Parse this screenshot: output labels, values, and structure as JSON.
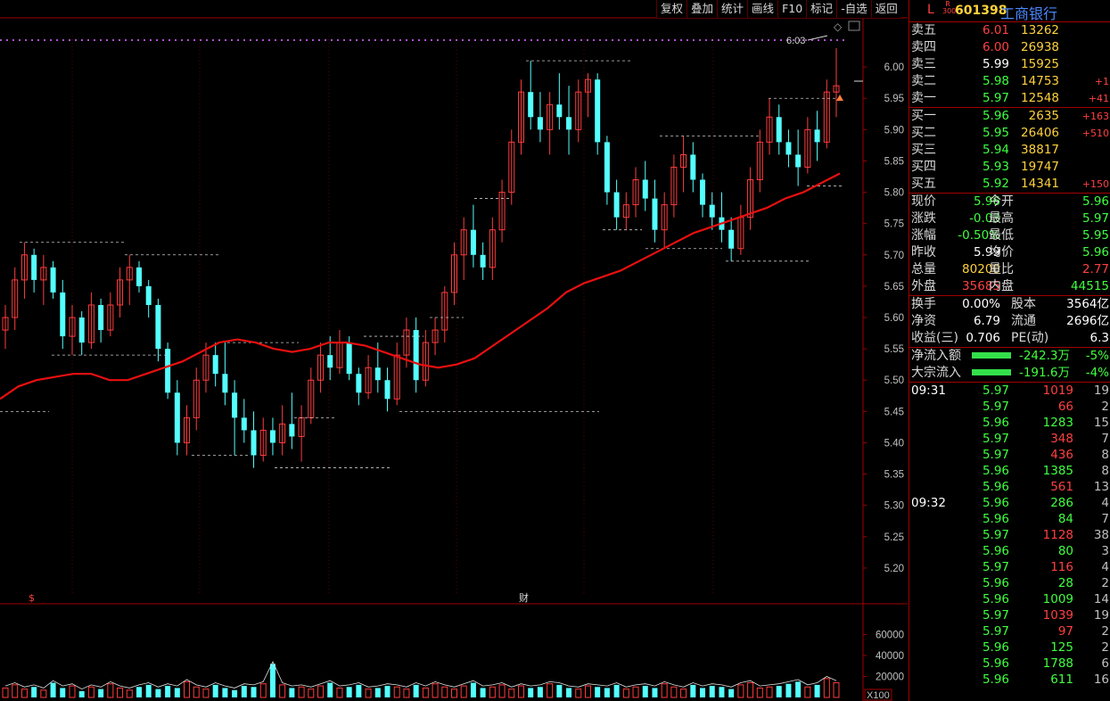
{
  "toolbar": {
    "buttons": [
      "复权",
      "叠加",
      "统计",
      "画线",
      "F10",
      "标记",
      "-自选",
      "返回"
    ]
  },
  "stock": {
    "flag": "L",
    "index_tag": "R 300",
    "code": "601398",
    "name": "工商银行"
  },
  "order_book": {
    "asks": [
      {
        "label": "卖五",
        "price": "6.01",
        "vol": "13262",
        "chg": ""
      },
      {
        "label": "卖四",
        "price": "6.00",
        "vol": "26938",
        "chg": ""
      },
      {
        "label": "卖三",
        "price": "5.99",
        "vol": "15925",
        "chg": ""
      },
      {
        "label": "卖二",
        "price": "5.98",
        "vol": "14753",
        "chg": "+1"
      },
      {
        "label": "卖一",
        "price": "5.97",
        "vol": "12548",
        "chg": "+41"
      }
    ],
    "bids": [
      {
        "label": "买一",
        "price": "5.96",
        "vol": "2635",
        "chg": "+163"
      },
      {
        "label": "买二",
        "price": "5.95",
        "vol": "26406",
        "chg": "+510"
      },
      {
        "label": "买三",
        "price": "5.94",
        "vol": "38817",
        "chg": ""
      },
      {
        "label": "买四",
        "price": "5.93",
        "vol": "19747",
        "chg": ""
      },
      {
        "label": "买五",
        "price": "5.92",
        "vol": "14341",
        "chg": "+150"
      }
    ]
  },
  "quote": {
    "xianjia_l": "现价",
    "xianjia": "5.96",
    "jinkai_l": "今开",
    "jinkai": "5.96",
    "zhangdie_l": "涨跌",
    "zhangdie": "-0.03",
    "zuigao_l": "最高",
    "zuigao": "5.97",
    "zhangfu_l": "涨幅",
    "zhangfu": "-0.50%",
    "zuidi_l": "最低",
    "zuidi": "5.95",
    "zuoshou_l": "昨收",
    "zuoshou": "5.99",
    "junjia_l": "均价",
    "junjia": "5.96",
    "zongliang_l": "总量",
    "zongliang": "80200",
    "liangbi_l": "量比",
    "liangbi": "2.77",
    "waipan_l": "外盘",
    "waipan": "35685",
    "neipan_l": "内盘",
    "neipan": "44515"
  },
  "fundamentals": {
    "huanshou_l": "换手",
    "huanshou": "0.00%",
    "guben_l": "股本",
    "guben": "3564亿",
    "jingzi_l": "净资",
    "jingzi": "6.79",
    "liutong_l": "流通",
    "liutong": "2696亿",
    "shouyi_l": "收益(三)",
    "shouyi": "0.706",
    "pe_l": "PE(动)",
    "pe": "6.3"
  },
  "flows": [
    {
      "label": "净流入额",
      "value": "-242.3万",
      "pct": "-5%"
    },
    {
      "label": "大宗流入",
      "value": "-191.6万",
      "pct": "-4%"
    }
  ],
  "ticks": [
    {
      "time": "09:31",
      "price": "5.97",
      "vol": "1019",
      "n": "19",
      "dir": "up",
      "pdir": "dn"
    },
    {
      "time": "",
      "price": "5.97",
      "vol": "66",
      "n": "2",
      "dir": "up",
      "pdir": "dn"
    },
    {
      "time": "",
      "price": "5.96",
      "vol": "1283",
      "n": "15",
      "dir": "dn",
      "pdir": "dn"
    },
    {
      "time": "",
      "price": "5.97",
      "vol": "348",
      "n": "7",
      "dir": "up",
      "pdir": "dn"
    },
    {
      "time": "",
      "price": "5.97",
      "vol": "436",
      "n": "8",
      "dir": "up",
      "pdir": "dn"
    },
    {
      "time": "",
      "price": "5.96",
      "vol": "1385",
      "n": "8",
      "dir": "dn",
      "pdir": "dn"
    },
    {
      "time": "",
      "price": "5.96",
      "vol": "561",
      "n": "13",
      "dir": "up",
      "pdir": "dn"
    },
    {
      "time": "09:32",
      "price": "5.96",
      "vol": "286",
      "n": "4",
      "dir": "dn",
      "pdir": "dn"
    },
    {
      "time": "",
      "price": "5.96",
      "vol": "84",
      "n": "7",
      "dir": "dn",
      "pdir": "dn"
    },
    {
      "time": "",
      "price": "5.97",
      "vol": "1128",
      "n": "38",
      "dir": "up",
      "pdir": "dn"
    },
    {
      "time": "",
      "price": "5.96",
      "vol": "80",
      "n": "3",
      "dir": "dn",
      "pdir": "dn"
    },
    {
      "time": "",
      "price": "5.97",
      "vol": "116",
      "n": "4",
      "dir": "up",
      "pdir": "dn"
    },
    {
      "time": "",
      "price": "5.96",
      "vol": "28",
      "n": "2",
      "dir": "dn",
      "pdir": "dn"
    },
    {
      "time": "",
      "price": "5.96",
      "vol": "1009",
      "n": "14",
      "dir": "dn",
      "pdir": "dn"
    },
    {
      "time": "",
      "price": "5.97",
      "vol": "1039",
      "n": "19",
      "dir": "up",
      "pdir": "dn"
    },
    {
      "time": "",
      "price": "5.97",
      "vol": "97",
      "n": "2",
      "dir": "up",
      "pdir": "dn"
    },
    {
      "time": "",
      "price": "5.96",
      "vol": "125",
      "n": "2",
      "dir": "dn",
      "pdir": "dn"
    },
    {
      "time": "",
      "price": "5.96",
      "vol": "1788",
      "n": "6",
      "dir": "dn",
      "pdir": "dn"
    },
    {
      "time": "",
      "price": "5.96",
      "vol": "611",
      "n": "16",
      "dir": "dn",
      "pdir": "dn"
    }
  ],
  "chart_data": {
    "type": "candlestick",
    "price_axis": {
      "ticks": [
        "6.00",
        "5.95",
        "5.90",
        "5.85",
        "5.80",
        "5.75",
        "5.70",
        "5.65",
        "5.60",
        "5.55",
        "5.50",
        "5.45",
        "5.40",
        "5.35",
        "5.30",
        "5.25",
        "5.20"
      ],
      "ylim": [
        5.16,
        6.05
      ]
    },
    "volume_axis": {
      "ticks": [
        "60000",
        "40000",
        "20000"
      ],
      "unit": "X100",
      "ylim": [
        0,
        80000
      ]
    },
    "annotations": {
      "high_label": "6.03",
      "event_marker_1": "$",
      "event_marker_2": "财"
    },
    "colors": {
      "up": "#ff3c3c",
      "down": "#54ffff",
      "ma": "#e81010",
      "dash": "#c8c8c8"
    },
    "candles": [
      [
        5.58,
        5.62,
        5.55,
        5.6
      ],
      [
        5.6,
        5.68,
        5.58,
        5.66
      ],
      [
        5.66,
        5.72,
        5.63,
        5.7
      ],
      [
        5.7,
        5.71,
        5.64,
        5.66
      ],
      [
        5.66,
        5.7,
        5.62,
        5.68
      ],
      [
        5.68,
        5.69,
        5.63,
        5.64
      ],
      [
        5.64,
        5.66,
        5.55,
        5.57
      ],
      [
        5.57,
        5.62,
        5.54,
        5.6
      ],
      [
        5.6,
        5.61,
        5.54,
        5.56
      ],
      [
        5.56,
        5.64,
        5.55,
        5.62
      ],
      [
        5.62,
        5.63,
        5.56,
        5.58
      ],
      [
        5.58,
        5.64,
        5.57,
        5.62
      ],
      [
        5.62,
        5.68,
        5.6,
        5.66
      ],
      [
        5.66,
        5.7,
        5.62,
        5.68
      ],
      [
        5.68,
        5.69,
        5.64,
        5.65
      ],
      [
        5.65,
        5.66,
        5.6,
        5.62
      ],
      [
        5.62,
        5.63,
        5.53,
        5.55
      ],
      [
        5.55,
        5.56,
        5.47,
        5.48
      ],
      [
        5.48,
        5.5,
        5.38,
        5.4
      ],
      [
        5.4,
        5.46,
        5.38,
        5.44
      ],
      [
        5.44,
        5.52,
        5.42,
        5.5
      ],
      [
        5.5,
        5.56,
        5.48,
        5.54
      ],
      [
        5.54,
        5.56,
        5.49,
        5.51
      ],
      [
        5.51,
        5.56,
        5.46,
        5.48
      ],
      [
        5.48,
        5.5,
        5.38,
        5.44
      ],
      [
        5.44,
        5.47,
        5.4,
        5.42
      ],
      [
        5.42,
        5.45,
        5.36,
        5.38
      ],
      [
        5.38,
        5.44,
        5.37,
        5.42
      ],
      [
        5.42,
        5.44,
        5.38,
        5.4
      ],
      [
        5.4,
        5.46,
        5.38,
        5.43
      ],
      [
        5.43,
        5.48,
        5.39,
        5.41
      ],
      [
        5.41,
        5.46,
        5.37,
        5.44
      ],
      [
        5.44,
        5.52,
        5.43,
        5.5
      ],
      [
        5.5,
        5.56,
        5.48,
        5.54
      ],
      [
        5.54,
        5.57,
        5.5,
        5.52
      ],
      [
        5.52,
        5.58,
        5.51,
        5.56
      ],
      [
        5.56,
        5.57,
        5.5,
        5.51
      ],
      [
        5.51,
        5.52,
        5.46,
        5.48
      ],
      [
        5.48,
        5.54,
        5.47,
        5.52
      ],
      [
        5.52,
        5.56,
        5.48,
        5.5
      ],
      [
        5.5,
        5.52,
        5.45,
        5.47
      ],
      [
        5.47,
        5.56,
        5.46,
        5.54
      ],
      [
        5.54,
        5.6,
        5.52,
        5.58
      ],
      [
        5.58,
        5.6,
        5.48,
        5.5
      ],
      [
        5.5,
        5.58,
        5.49,
        5.56
      ],
      [
        5.56,
        5.6,
        5.54,
        5.58
      ],
      [
        5.58,
        5.65,
        5.56,
        5.64
      ],
      [
        5.64,
        5.72,
        5.62,
        5.7
      ],
      [
        5.7,
        5.76,
        5.66,
        5.74
      ],
      [
        5.74,
        5.78,
        5.68,
        5.7
      ],
      [
        5.7,
        5.72,
        5.66,
        5.68
      ],
      [
        5.68,
        5.76,
        5.66,
        5.74
      ],
      [
        5.74,
        5.82,
        5.72,
        5.8
      ],
      [
        5.8,
        5.9,
        5.78,
        5.88
      ],
      [
        5.88,
        5.98,
        5.86,
        5.96
      ],
      [
        5.96,
        6.01,
        5.9,
        5.92
      ],
      [
        5.92,
        5.96,
        5.88,
        5.9
      ],
      [
        5.9,
        5.96,
        5.86,
        5.94
      ],
      [
        5.94,
        5.99,
        5.9,
        5.92
      ],
      [
        5.92,
        5.97,
        5.86,
        5.9
      ],
      [
        5.9,
        5.98,
        5.88,
        5.96
      ],
      [
        5.96,
        5.99,
        5.92,
        5.98
      ],
      [
        5.98,
        5.99,
        5.86,
        5.88
      ],
      [
        5.88,
        5.89,
        5.78,
        5.8
      ],
      [
        5.8,
        5.82,
        5.74,
        5.76
      ],
      [
        5.76,
        5.8,
        5.74,
        5.78
      ],
      [
        5.78,
        5.84,
        5.76,
        5.82
      ],
      [
        5.82,
        5.85,
        5.77,
        5.79
      ],
      [
        5.79,
        5.82,
        5.72,
        5.74
      ],
      [
        5.74,
        5.8,
        5.71,
        5.78
      ],
      [
        5.78,
        5.86,
        5.76,
        5.84
      ],
      [
        5.84,
        5.89,
        5.8,
        5.86
      ],
      [
        5.86,
        5.88,
        5.8,
        5.82
      ],
      [
        5.82,
        5.83,
        5.76,
        5.78
      ],
      [
        5.78,
        5.8,
        5.74,
        5.76
      ],
      [
        5.76,
        5.8,
        5.72,
        5.74
      ],
      [
        5.74,
        5.76,
        5.69,
        5.71
      ],
      [
        5.71,
        5.78,
        5.7,
        5.76
      ],
      [
        5.76,
        5.84,
        5.74,
        5.82
      ],
      [
        5.82,
        5.9,
        5.8,
        5.88
      ],
      [
        5.88,
        5.95,
        5.86,
        5.92
      ],
      [
        5.92,
        5.94,
        5.86,
        5.88
      ],
      [
        5.88,
        5.9,
        5.84,
        5.86
      ],
      [
        5.86,
        5.9,
        5.81,
        5.84
      ],
      [
        5.84,
        5.92,
        5.83,
        5.9
      ],
      [
        5.9,
        5.93,
        5.85,
        5.88
      ],
      [
        5.88,
        5.98,
        5.87,
        5.96
      ],
      [
        5.96,
        6.03,
        5.92,
        5.97
      ]
    ],
    "ma": [
      5.47,
      5.49,
      5.5,
      5.505,
      5.51,
      5.51,
      5.5,
      5.5,
      5.51,
      5.52,
      5.53,
      5.545,
      5.56,
      5.565,
      5.56,
      5.55,
      5.545,
      5.55,
      5.56,
      5.56,
      5.555,
      5.545,
      5.535,
      5.525,
      5.52,
      5.525,
      5.535,
      5.555,
      5.575,
      5.595,
      5.615,
      5.64,
      5.655,
      5.665,
      5.675,
      5.69,
      5.705,
      5.72,
      5.735,
      5.745,
      5.755,
      5.765,
      5.775,
      5.79,
      5.8,
      5.815,
      5.83
    ],
    "volumes": [
      9,
      12,
      8,
      10,
      7,
      14,
      9,
      11,
      6,
      10,
      8,
      13,
      9,
      7,
      10,
      12,
      8,
      11,
      9,
      15,
      10,
      8,
      12,
      9,
      7,
      11,
      10,
      13,
      32,
      12,
      9,
      10,
      8,
      11,
      14,
      9,
      10,
      12,
      8,
      9,
      11,
      10,
      8,
      12,
      9,
      13,
      10,
      8,
      11,
      14,
      9,
      10,
      12,
      8,
      11,
      9,
      10,
      13,
      12,
      9,
      8,
      11,
      10,
      9,
      12,
      8,
      10,
      11,
      9,
      13,
      10,
      8,
      12,
      9,
      11,
      10,
      8,
      12,
      14,
      9,
      10,
      11,
      13,
      15,
      10,
      12,
      18,
      14
    ]
  }
}
